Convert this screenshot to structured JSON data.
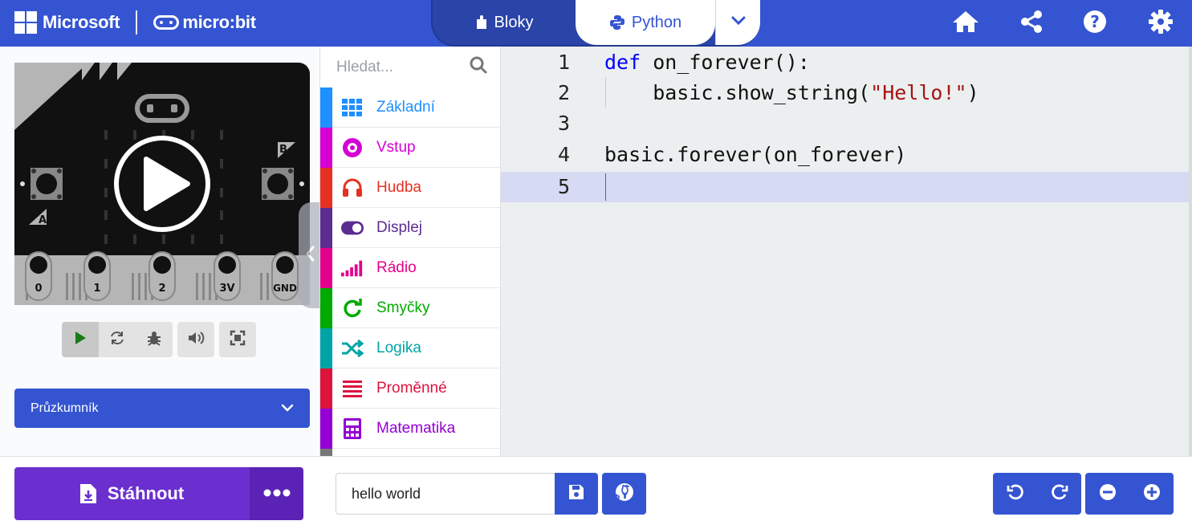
{
  "header": {
    "brand_ms": "Microsoft",
    "brand_product": "micro:bit",
    "modes": {
      "blocks": "Bloky",
      "python": "Python",
      "active": "python"
    },
    "icons": [
      "home-icon",
      "share-icon",
      "help-icon",
      "settings-icon"
    ]
  },
  "simulator": {
    "pin_labels": [
      "0",
      "1",
      "2",
      "3V",
      "GND"
    ],
    "button_labels": [
      "A",
      "B"
    ],
    "toolbar": [
      "play-icon",
      "restart-icon",
      "debug-icon",
      "mute-icon",
      "fullscreen-icon"
    ],
    "explorer_label": "Průzkumník"
  },
  "toolbox": {
    "search_placeholder": "Hledat...",
    "categories": [
      {
        "label": "Základní",
        "color": "#1e90ff",
        "icon": "grid-icon"
      },
      {
        "label": "Vstup",
        "color": "#d400d4",
        "icon": "target-icon"
      },
      {
        "label": "Hudba",
        "color": "#e63022",
        "icon": "headphones-icon"
      },
      {
        "label": "Displej",
        "color": "#5c2d91",
        "icon": "toggle-icon"
      },
      {
        "label": "Rádio",
        "color": "#e3008c",
        "icon": "signal-icon"
      },
      {
        "label": "Smyčky",
        "color": "#00aa00",
        "icon": "loop-icon"
      },
      {
        "label": "Logika",
        "color": "#00a4a6",
        "icon": "shuffle-icon"
      },
      {
        "label": "Proměnné",
        "color": "#dc143c",
        "icon": "lines-icon"
      },
      {
        "label": "Matematika",
        "color": "#9400d3",
        "icon": "calculator-icon"
      }
    ]
  },
  "editor": {
    "line_numbers": [
      "1",
      "2",
      "3",
      "4",
      "5"
    ],
    "lines": {
      "l1_kw": "def",
      "l1_rest": " on_forever():",
      "l2_pre": "    basic.show_string(",
      "l2_str": "\"Hello!\"",
      "l2_post": ")",
      "l4": "basic.forever(on_forever)"
    },
    "active_line": "5"
  },
  "footer": {
    "download_label": "Stáhnout",
    "project_name": "hello world"
  },
  "colors": {
    "accent": "#3454d1",
    "download": "#6b2fd0"
  }
}
